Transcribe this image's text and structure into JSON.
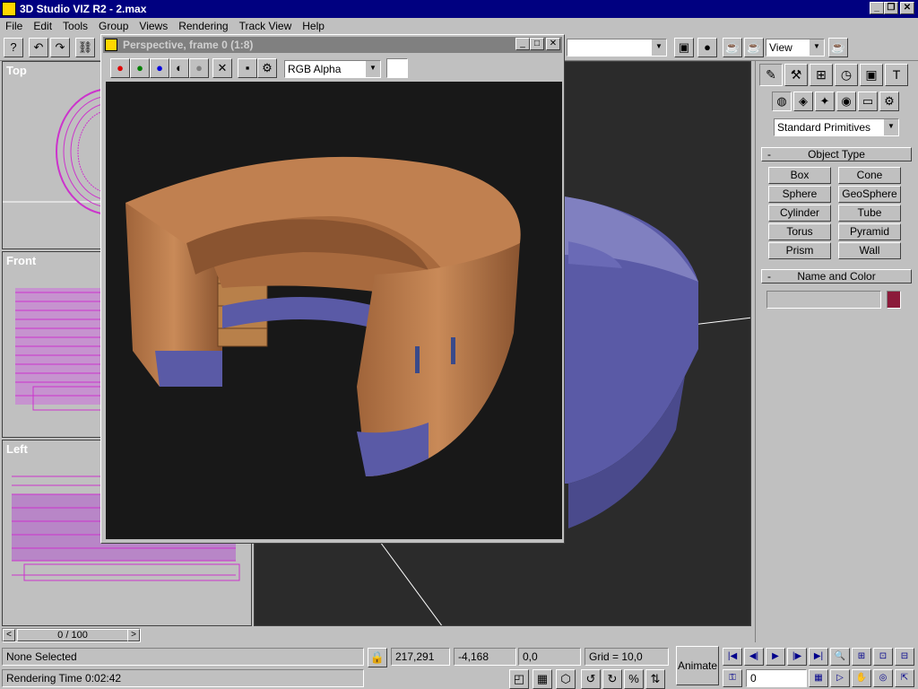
{
  "app": {
    "title": "3D Studio VIZ R2 - 2.max"
  },
  "menu": [
    "File",
    "Edit",
    "Tools",
    "Group",
    "Views",
    "Rendering",
    "Track View",
    "Help"
  ],
  "toolbar": {
    "view_combo": "View"
  },
  "viewports": {
    "top": "Top",
    "front": "Front",
    "left": "Left"
  },
  "render_window": {
    "title": "Perspective, frame 0 (1:8)",
    "channel_combo": "RGB Alpha"
  },
  "command_panel": {
    "category_combo": "Standard Primitives",
    "object_type_title": "Object Type",
    "buttons": [
      "Box",
      "Cone",
      "Sphere",
      "GeoSphere",
      "Cylinder",
      "Tube",
      "Torus",
      "Pyramid",
      "Prism",
      "Wall"
    ],
    "name_color_title": "Name and Color",
    "name_value": "",
    "swatch_color": "#8b1a3a"
  },
  "timeline": {
    "frame_label": "0 / 100"
  },
  "status": {
    "selection": "None Selected",
    "x": "217,291",
    "y": "-4,168",
    "z": "0,0",
    "grid": "Grid = 10,0",
    "render_time": "Rendering Time  0:02:42",
    "animate_label": "Animate",
    "frame_field": "0"
  },
  "colors": {
    "title_active": "#000080",
    "title_inactive": "#808080",
    "wire": "#cc33cc",
    "purple_surface": "#5a5aa6",
    "wood": "#b87a4a",
    "render_bg": "#181818",
    "desktop": "#c0c0c0"
  }
}
